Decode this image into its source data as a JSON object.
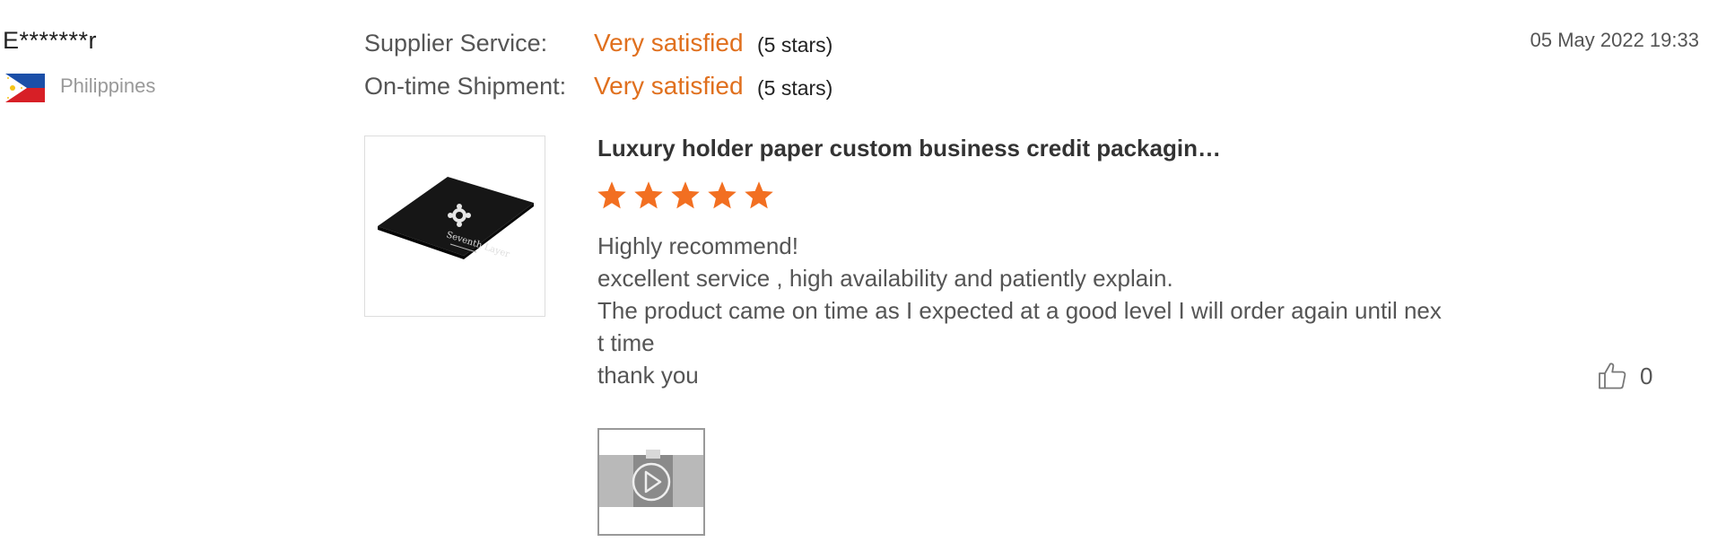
{
  "reviewer": {
    "name": "E*******r",
    "country": "Philippines",
    "flag_icon": "philippines-flag-icon"
  },
  "ratings": [
    {
      "label": "Supplier Service:",
      "value": "Very satisfied",
      "stars_text": "(5 stars)"
    },
    {
      "label": "On-time Shipment:",
      "value": "Very satisfied",
      "stars_text": "(5 stars)"
    }
  ],
  "date": "05 May 2022 19:33",
  "product": {
    "title": "Luxury holder paper custom business credit packagin…",
    "image_icon": "product-image-black-card-holder",
    "image_text": "Seventh Layer"
  },
  "star_rating": 5,
  "review": {
    "lines": [
      "Highly recommend!",
      "excellent service , high availability and patiently explain.",
      "The product came on time as I expected at a good level I will order again until nex",
      "t time",
      "thank you"
    ]
  },
  "like": {
    "icon": "thumbs-up-icon",
    "count": "0"
  },
  "media": {
    "icon": "play-icon"
  },
  "colors": {
    "accent": "#e0701e",
    "star": "#f26f21",
    "muted": "#999999",
    "text": "#555555"
  }
}
